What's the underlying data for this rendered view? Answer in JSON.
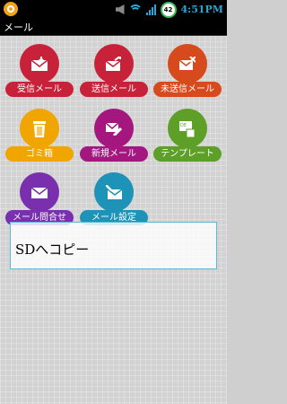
{
  "status_bar": {
    "time": "4:51PM",
    "battery_level": "42",
    "icons": [
      "app-notification-icon",
      "mute-icon",
      "wifi-icon",
      "signal-icon",
      "battery-icon"
    ]
  },
  "title_bar": {
    "title": "メール"
  },
  "menu": {
    "items": [
      {
        "label": "受信メール",
        "color": "#c8223a",
        "icon": "inbox-icon"
      },
      {
        "label": "送信メール",
        "color": "#c8223a",
        "icon": "outbox-icon"
      },
      {
        "label": "未送信メール",
        "color": "#d64a1d",
        "icon": "unsent-mail-icon"
      },
      {
        "label": "ゴミ箱",
        "color": "#f0a500",
        "icon": "trash-icon"
      },
      {
        "label": "新規メール",
        "color": "#a3177f",
        "icon": "new-mail-icon"
      },
      {
        "label": "テンプレート",
        "color": "#5d9f27",
        "icon": "template-icon"
      },
      {
        "label": "メール問合せ",
        "color": "#7a2fae",
        "icon": "mail-inquiry-icon"
      },
      {
        "label": "メール設定",
        "color": "#1d93b8",
        "icon": "mail-settings-icon"
      }
    ]
  },
  "dialog": {
    "option_label": "SDへコピー"
  }
}
